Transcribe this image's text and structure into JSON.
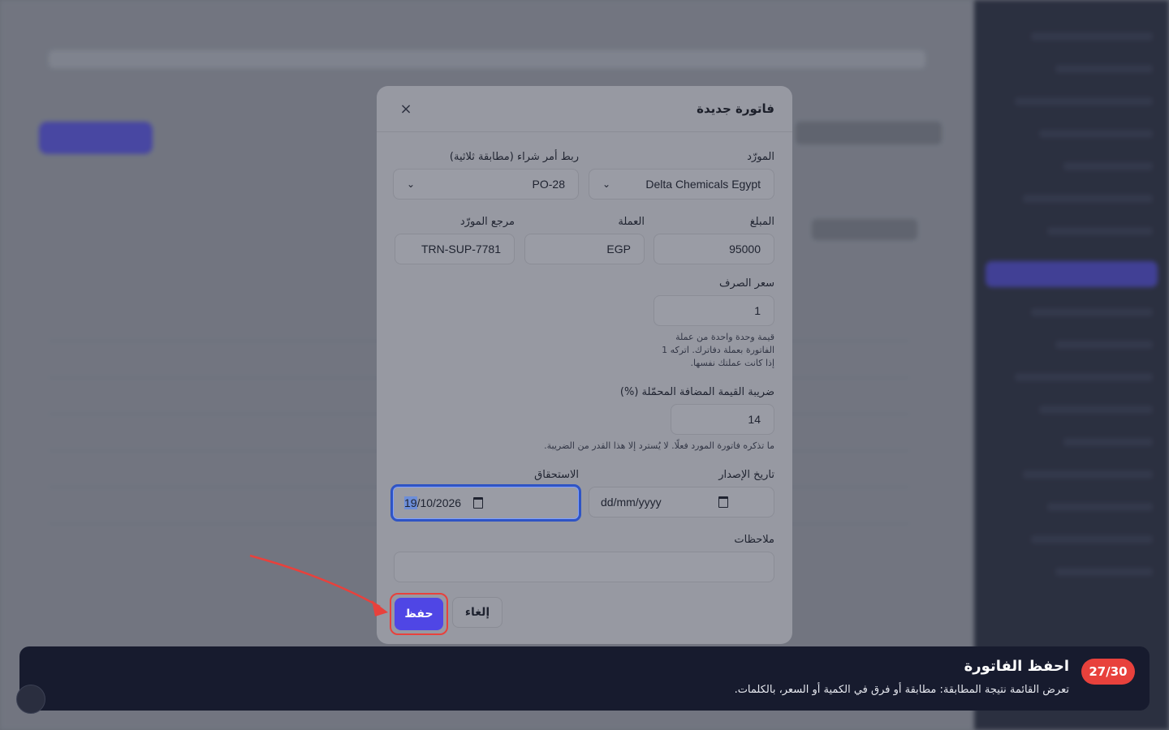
{
  "modal": {
    "title": "فاتورة جديدة",
    "close_symbol": "×",
    "fields": {
      "supplier": {
        "label": "المورّد",
        "value": "Delta Chemicals Egypt"
      },
      "po_link": {
        "label": "ربط أمر شراء (مطابقة ثلاثية)",
        "value": "PO-28"
      },
      "amount": {
        "label": "المبلغ",
        "value": "95000"
      },
      "currency": {
        "label": "العملة",
        "value": "EGP"
      },
      "supplier_ref": {
        "label": "مرجع المورّد",
        "value": "TRN-SUP-7781"
      },
      "exchange_rate": {
        "label": "سعر الصرف",
        "value": "1",
        "hint_lines": [
          "قيمة وحدة واحدة من عملة",
          "الفاتورة بعملة دفاترك. اتركه 1",
          "إذا كانت عملتك نفسها."
        ]
      },
      "vat": {
        "label": "ضريبة القيمة المضافة المحمّلة (%)",
        "value": "14",
        "hint": "ما تذكره فاتورة المورد فعلًا. لا يُسترد إلا هذا القدر من الضريبة."
      },
      "issue_date": {
        "label": "تاريخ الإصدار",
        "value": "dd/mm/yyyy"
      },
      "due_date": {
        "label": "الاستحقاق",
        "value_day": "19",
        "value_rest": "/10/2026"
      },
      "notes": {
        "label": "ملاحظات",
        "value": ""
      }
    },
    "buttons": {
      "save": "حفظ",
      "cancel": "إلغاء"
    }
  },
  "banner": {
    "step": "27/30",
    "title": "احفظ الفاتورة",
    "description": "تعرض القائمة نتيجة المطابقة: مطابقة أو فرق في الكمية أو السعر، بالكلمات."
  },
  "colors": {
    "accent": "#4f46e5",
    "highlight": "#e8413c",
    "focus": "#2f54c4",
    "banner_bg": "#171b2e"
  },
  "icons": [
    "close-icon",
    "chevron-down-icon",
    "calendar-icon",
    "arrow-pointer"
  ]
}
